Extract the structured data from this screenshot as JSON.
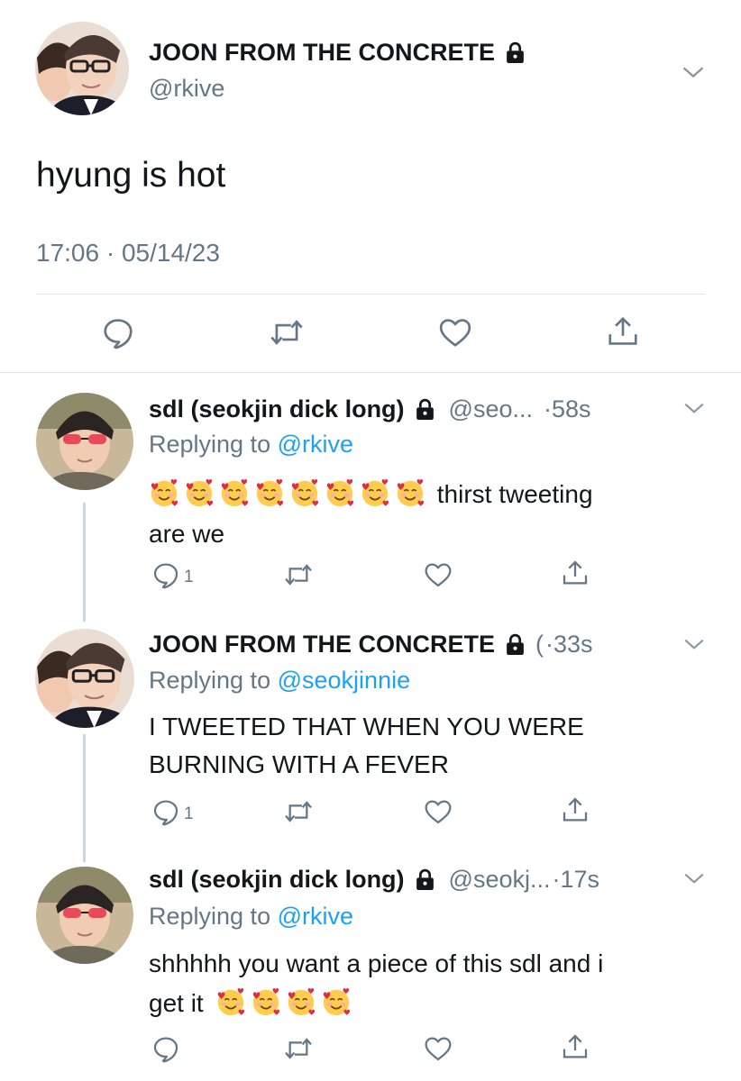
{
  "main_tweet": {
    "display_name": "JOON FROM THE CONCRETE",
    "handle": "@rkive",
    "text": "hyung is hot",
    "timestamp": "17:06 · 05/14/23",
    "icons": [
      "reply-icon",
      "retweet-icon",
      "like-icon",
      "share-icon"
    ]
  },
  "replies": [
    {
      "display_name": "sdl (seokjin dick long)",
      "handle": "@seo...",
      "time": "·58s",
      "replying_prefix": "Replying to",
      "replying_handle": "@rkive",
      "text_line1": "thirst tweeting",
      "text_line2": "are we",
      "emoji_count_shown": 8,
      "reply_count": "1"
    },
    {
      "display_name": "JOON FROM THE CONCRETE",
      "handle": "(",
      "time": "·33s",
      "replying_prefix": "Replying to",
      "replying_handle": "@seokjinnie",
      "text_line1": "I TWEETED THAT WHEN YOU WERE",
      "text_line2": "BURNING WITH A FEVER",
      "reply_count": "1"
    },
    {
      "display_name": "sdl (seokjin dick long)",
      "handle": "@seokj...",
      "time": "·17s",
      "replying_prefix": "Replying to",
      "replying_handle": "@rkive",
      "text_line1": "shhhhh you want a piece of this sdl and i",
      "text_line2": "get it",
      "emoji_count_shown": 4
    }
  ],
  "colors": {
    "text": "#14171a",
    "secondary": "#657786",
    "link": "#1da1f2",
    "divider": "#e1e8ed",
    "thread_line": "#ccd6dd"
  }
}
